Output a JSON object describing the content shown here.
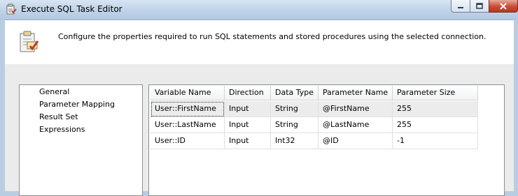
{
  "window": {
    "title": "Execute SQL Task Editor",
    "controls": [
      "minimize",
      "maximize",
      "close"
    ]
  },
  "header": {
    "description": "Configure the properties required to run SQL statements and stored procedures using the selected connection."
  },
  "nav": {
    "items": [
      {
        "label": "General"
      },
      {
        "label": "Parameter Mapping",
        "selected": true
      },
      {
        "label": "Result Set"
      },
      {
        "label": "Expressions"
      }
    ]
  },
  "grid": {
    "columns": [
      "Variable Name",
      "Direction",
      "Data Type",
      "Parameter Name",
      "Parameter Size"
    ],
    "rows": [
      {
        "variable": "User::FirstName",
        "direction": "Input",
        "type": "String",
        "param": "@FirstName",
        "size": "255"
      },
      {
        "variable": "User::LastName",
        "direction": "Input",
        "type": "String",
        "param": "@LastName",
        "size": "255"
      },
      {
        "variable": "User::ID",
        "direction": "Input",
        "type": "Int32",
        "param": "@ID",
        "size": "-1"
      }
    ]
  },
  "colors": {
    "frame": "#b9cde2",
    "body": "#ebebeb",
    "close_button": "#c94c36"
  }
}
